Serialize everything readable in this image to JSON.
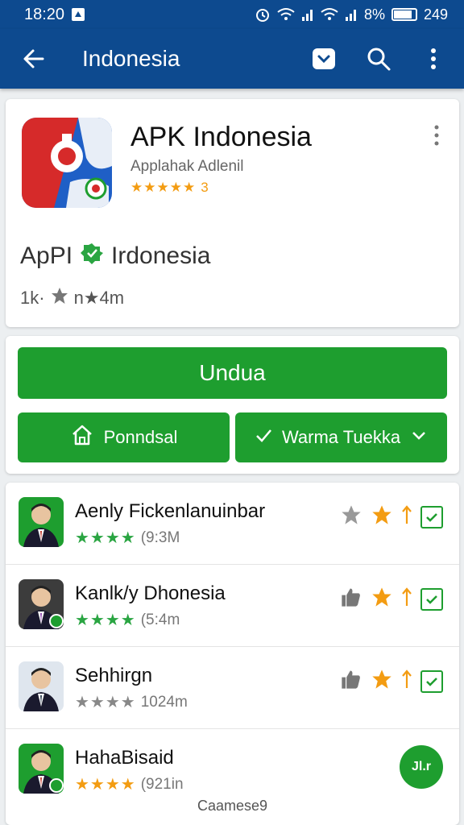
{
  "status_bar": {
    "time": "18:20",
    "battery_text": "8%",
    "extra_text": "249",
    "battery_level": 0.85,
    "icons": [
      "alarm-icon",
      "wifi-icon",
      "signal-icon",
      "battery-icon"
    ]
  },
  "app_bar": {
    "title": "Indonesia",
    "icons": [
      "back-arrow-icon",
      "bookmark-icon",
      "search-icon",
      "more-vert-icon"
    ]
  },
  "app": {
    "title": "APK Indonesia",
    "developer": "Applahak Adlenil",
    "rating_stars": "★★★★★",
    "rating_count": "3",
    "subtitle_left": "ApPI",
    "subtitle_right": "Irdonesia",
    "stats_left": "1k·",
    "stats_right": "n★4m"
  },
  "actions": {
    "primary_label": "Undua",
    "home_label": "Ponndsal",
    "wish_label": "Warma Tuekka"
  },
  "list": [
    {
      "title": "Aenly Fickenlanuinbar",
      "stars": "★★★★",
      "meta": "(9:3M",
      "star_color": "#2aa542",
      "actions": [
        "star-icon",
        "star-icon",
        "upload-icon",
        "check-icon"
      ]
    },
    {
      "title": "Kanlk/y Dhonesia",
      "stars": "★★★★",
      "meta": "(5:4m",
      "star_color": "#2aa542",
      "actions": [
        "thumb-up-icon",
        "star-icon",
        "upload-icon",
        "check-icon"
      ]
    },
    {
      "title": "Sehhirgn",
      "stars": "★★★★",
      "meta": "1024m",
      "star_color": "#888888",
      "actions": [
        "thumb-up-icon",
        "star-icon",
        "upload-icon",
        "check-icon"
      ]
    },
    {
      "title": "HahaBisaid",
      "stars": "★★★★",
      "meta": "(921in",
      "star_color": "#f39c12",
      "fab_label": "Jl.r"
    }
  ],
  "footer": "Caamese9",
  "colors": {
    "primary_blue": "#0d4a8f",
    "green": "#1e9e2f",
    "orange": "#f39c12"
  }
}
